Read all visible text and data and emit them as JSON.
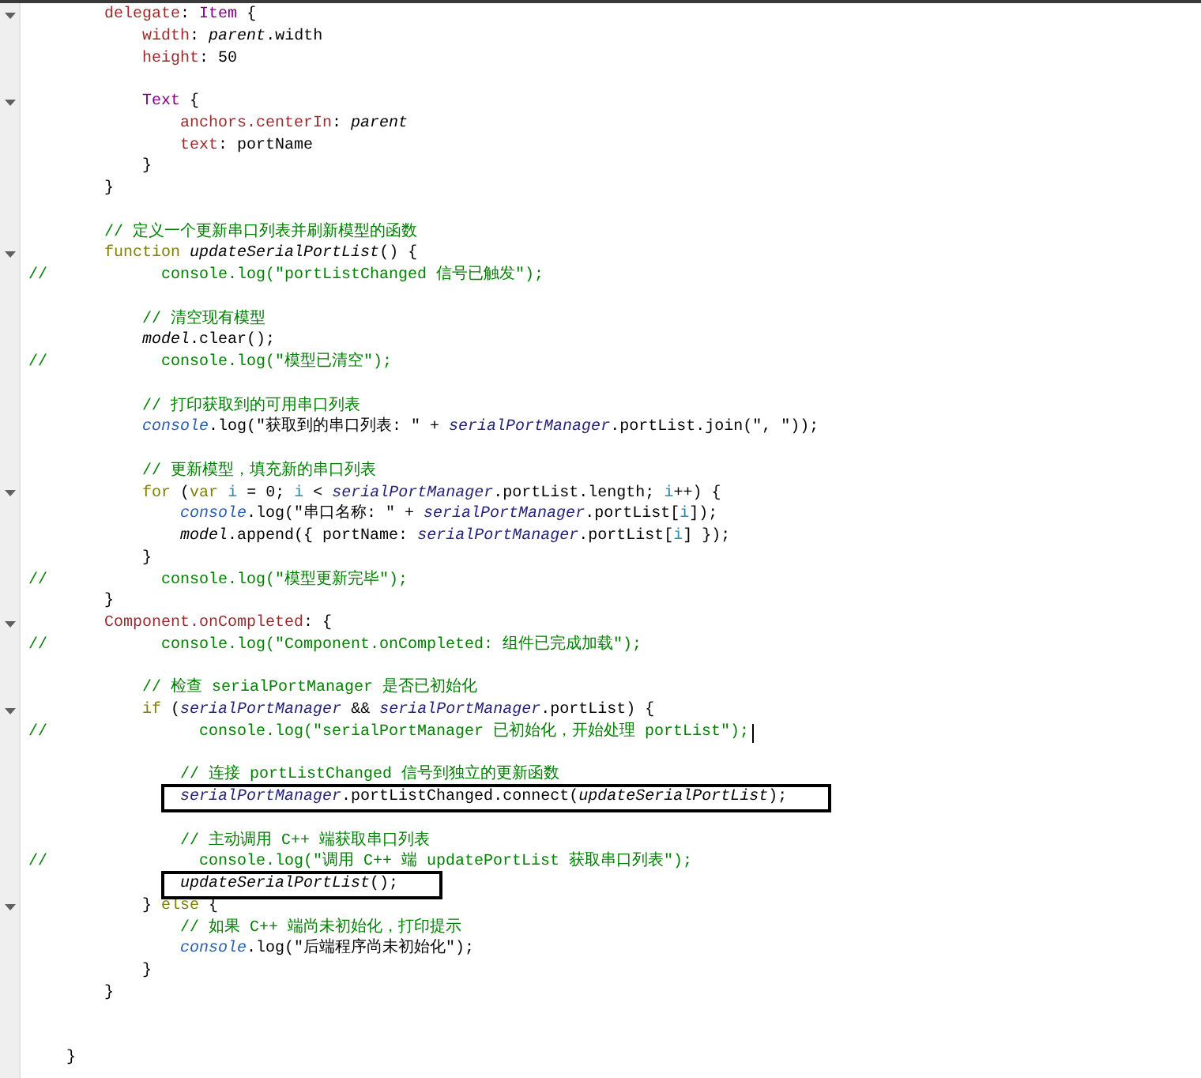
{
  "editor": {
    "lines": [
      {
        "fold": true,
        "boxed": false,
        "cursor": false,
        "tokens": [
          {
            "kind": "property",
            "text": "        delegate"
          },
          {
            "kind": "plain",
            "text": ": "
          },
          {
            "kind": "type",
            "text": "Item"
          },
          {
            "kind": "plain",
            "text": " {"
          }
        ]
      },
      {
        "fold": false,
        "boxed": false,
        "cursor": false,
        "tokens": [
          {
            "kind": "property",
            "text": "            width"
          },
          {
            "kind": "plain",
            "text": ": "
          },
          {
            "kind": "italic",
            "text": "parent"
          },
          {
            "kind": "plain",
            "text": ".width"
          }
        ]
      },
      {
        "fold": false,
        "boxed": false,
        "cursor": false,
        "tokens": [
          {
            "kind": "property",
            "text": "            height"
          },
          {
            "kind": "plain",
            "text": ": 50"
          }
        ]
      },
      {
        "fold": false,
        "boxed": false,
        "cursor": false
      },
      {
        "fold": true,
        "boxed": false,
        "cursor": false,
        "tokens": [
          {
            "kind": "type",
            "text": "            Text"
          },
          {
            "kind": "plain",
            "text": " {"
          }
        ]
      },
      {
        "fold": false,
        "boxed": false,
        "cursor": false,
        "tokens": [
          {
            "kind": "property",
            "text": "                anchors.centerIn"
          },
          {
            "kind": "plain",
            "text": ": "
          },
          {
            "kind": "italic",
            "text": "parent"
          }
        ]
      },
      {
        "fold": false,
        "boxed": false,
        "cursor": false,
        "tokens": [
          {
            "kind": "property",
            "text": "                text"
          },
          {
            "kind": "plain",
            "text": ": portName"
          }
        ]
      },
      {
        "fold": false,
        "boxed": false,
        "cursor": false,
        "tokens": [
          {
            "kind": "plain",
            "text": "            }"
          }
        ]
      },
      {
        "fold": false,
        "boxed": false,
        "cursor": false,
        "tokens": [
          {
            "kind": "plain",
            "text": "        }"
          }
        ]
      },
      {
        "fold": false,
        "boxed": false,
        "cursor": false
      },
      {
        "fold": false,
        "boxed": false,
        "cursor": false,
        "tokens": [
          {
            "kind": "comment",
            "text": "        // 定义一个更新串口列表并刷新模型的函数"
          }
        ]
      },
      {
        "fold": true,
        "boxed": false,
        "cursor": false,
        "tokens": [
          {
            "kind": "keyword",
            "text": "        function"
          },
          {
            "kind": "italic",
            "text": " updateSerialPortList"
          },
          {
            "kind": "plain",
            "text": "() {"
          }
        ]
      },
      {
        "fold": false,
        "boxed": false,
        "cursor": false,
        "tokens": [
          {
            "kind": "comment",
            "text": "//            console.log(\"portListChanged 信号已触发\");"
          }
        ]
      },
      {
        "fold": false,
        "boxed": false,
        "cursor": false
      },
      {
        "fold": false,
        "boxed": false,
        "cursor": false,
        "tokens": [
          {
            "kind": "comment",
            "text": "            // 清空现有模型"
          }
        ]
      },
      {
        "fold": false,
        "boxed": false,
        "cursor": false,
        "tokens": [
          {
            "kind": "italic",
            "text": "            model"
          },
          {
            "kind": "plain",
            "text": ".clear();"
          }
        ]
      },
      {
        "fold": false,
        "boxed": false,
        "cursor": false,
        "tokens": [
          {
            "kind": "comment",
            "text": "//            console.log(\"模型已清空\");"
          }
        ]
      },
      {
        "fold": false,
        "boxed": false,
        "cursor": false
      },
      {
        "fold": false,
        "boxed": false,
        "cursor": false,
        "tokens": [
          {
            "kind": "comment",
            "text": "            // 打印获取到的可用串口列表"
          }
        ]
      },
      {
        "fold": false,
        "boxed": false,
        "cursor": false,
        "tokens": [
          {
            "kind": "builtin",
            "text": "            console"
          },
          {
            "kind": "plain",
            "text": ".log(\"获取到的串口列表: \" + "
          },
          {
            "kind": "object",
            "text": "serialPortManager"
          },
          {
            "kind": "plain",
            "text": ".portList.join(\", \"));"
          }
        ]
      },
      {
        "fold": false,
        "boxed": false,
        "cursor": false
      },
      {
        "fold": false,
        "boxed": false,
        "cursor": false,
        "tokens": [
          {
            "kind": "comment",
            "text": "            // 更新模型，填充新的串口列表"
          }
        ]
      },
      {
        "fold": true,
        "boxed": false,
        "cursor": false,
        "tokens": [
          {
            "kind": "keyword",
            "text": "            for"
          },
          {
            "kind": "plain",
            "text": " ("
          },
          {
            "kind": "keyword",
            "text": "var"
          },
          {
            "kind": "local",
            "text": " i"
          },
          {
            "kind": "plain",
            "text": " = 0; "
          },
          {
            "kind": "local",
            "text": "i"
          },
          {
            "kind": "plain",
            "text": " < "
          },
          {
            "kind": "object",
            "text": "serialPortManager"
          },
          {
            "kind": "plain",
            "text": ".portList.length; "
          },
          {
            "kind": "local",
            "text": "i"
          },
          {
            "kind": "plain",
            "text": "++) {"
          }
        ]
      },
      {
        "fold": false,
        "boxed": false,
        "cursor": false,
        "tokens": [
          {
            "kind": "builtin",
            "text": "                console"
          },
          {
            "kind": "plain",
            "text": ".log(\"串口名称: \" + "
          },
          {
            "kind": "object",
            "text": "serialPortManager"
          },
          {
            "kind": "plain",
            "text": ".portList["
          },
          {
            "kind": "local",
            "text": "i"
          },
          {
            "kind": "plain",
            "text": "]);"
          }
        ]
      },
      {
        "fold": false,
        "boxed": false,
        "cursor": false,
        "tokens": [
          {
            "kind": "italic",
            "text": "                model"
          },
          {
            "kind": "plain",
            "text": ".append({ portName: "
          },
          {
            "kind": "object",
            "text": "serialPortManager"
          },
          {
            "kind": "plain",
            "text": ".portList["
          },
          {
            "kind": "local",
            "text": "i"
          },
          {
            "kind": "plain",
            "text": "] });"
          }
        ]
      },
      {
        "fold": false,
        "boxed": false,
        "cursor": false,
        "tokens": [
          {
            "kind": "plain",
            "text": "            }"
          }
        ]
      },
      {
        "fold": false,
        "boxed": false,
        "cursor": false,
        "tokens": [
          {
            "kind": "comment",
            "text": "//            console.log(\"模型更新完毕\");"
          }
        ]
      },
      {
        "fold": false,
        "boxed": false,
        "cursor": false,
        "tokens": [
          {
            "kind": "plain",
            "text": "        }"
          }
        ]
      },
      {
        "fold": true,
        "boxed": false,
        "cursor": false,
        "tokens": [
          {
            "kind": "property",
            "text": "        Component.onCompleted"
          },
          {
            "kind": "plain",
            "text": ": {"
          }
        ]
      },
      {
        "fold": false,
        "boxed": false,
        "cursor": false,
        "tokens": [
          {
            "kind": "comment",
            "text": "//            console.log(\"Component.onCompleted: 组件已完成加载\");"
          }
        ]
      },
      {
        "fold": false,
        "boxed": false,
        "cursor": false
      },
      {
        "fold": false,
        "boxed": false,
        "cursor": false,
        "tokens": [
          {
            "kind": "comment",
            "text": "            // 检查 serialPortManager 是否已初始化"
          }
        ]
      },
      {
        "fold": true,
        "boxed": false,
        "cursor": false,
        "tokens": [
          {
            "kind": "keyword",
            "text": "            if"
          },
          {
            "kind": "plain",
            "text": " ("
          },
          {
            "kind": "object",
            "text": "serialPortManager"
          },
          {
            "kind": "plain",
            "text": " && "
          },
          {
            "kind": "object",
            "text": "serialPortManager"
          },
          {
            "kind": "plain",
            "text": ".portList) {"
          }
        ]
      },
      {
        "fold": false,
        "boxed": false,
        "cursor": true,
        "tokens": [
          {
            "kind": "comment",
            "text": "//                console.log(\"serialPortManager 已初始化，开始处理 portList\");"
          }
        ]
      },
      {
        "fold": false,
        "boxed": false,
        "cursor": false
      },
      {
        "fold": false,
        "boxed": false,
        "cursor": false,
        "tokens": [
          {
            "kind": "comment",
            "text": "                // 连接 portListChanged 信号到独立的更新函数"
          }
        ]
      },
      {
        "fold": false,
        "boxed": true,
        "cursor": false,
        "tokens": [
          {
            "kind": "object",
            "text": "                serialPortManager"
          },
          {
            "kind": "plain",
            "text": ".portListChanged.connect("
          },
          {
            "kind": "italic",
            "text": "updateSerialPortList"
          },
          {
            "kind": "plain",
            "text": ");"
          }
        ]
      },
      {
        "fold": false,
        "boxed": false,
        "cursor": false
      },
      {
        "fold": false,
        "boxed": false,
        "cursor": false,
        "tokens": [
          {
            "kind": "comment",
            "text": "                // 主动调用 C++ 端获取串口列表"
          }
        ]
      },
      {
        "fold": false,
        "boxed": false,
        "cursor": false,
        "tokens": [
          {
            "kind": "comment",
            "text": "//                console.log(\"调用 C++ 端 updatePortList 获取串口列表\");"
          }
        ]
      },
      {
        "fold": false,
        "boxed": true,
        "cursor": false,
        "tokens": [
          {
            "kind": "italic",
            "text": "                updateSerialPortList"
          },
          {
            "kind": "plain",
            "text": "();"
          }
        ]
      },
      {
        "fold": true,
        "boxed": false,
        "cursor": false,
        "tokens": [
          {
            "kind": "plain",
            "text": "            } "
          },
          {
            "kind": "keyword",
            "text": "else"
          },
          {
            "kind": "plain",
            "text": " {"
          }
        ]
      },
      {
        "fold": false,
        "boxed": false,
        "cursor": false,
        "tokens": [
          {
            "kind": "comment",
            "text": "                // 如果 C++ 端尚未初始化，打印提示"
          }
        ]
      },
      {
        "fold": false,
        "boxed": false,
        "cursor": false,
        "tokens": [
          {
            "kind": "builtin",
            "text": "                console"
          },
          {
            "kind": "plain",
            "text": ".log(\"后端程序尚未初始化\");"
          }
        ]
      },
      {
        "fold": false,
        "boxed": false,
        "cursor": false,
        "tokens": [
          {
            "kind": "plain",
            "text": "            }"
          }
        ]
      },
      {
        "fold": false,
        "boxed": false,
        "cursor": false,
        "tokens": [
          {
            "kind": "plain",
            "text": "        }"
          }
        ]
      },
      {
        "fold": false,
        "boxed": false,
        "cursor": false
      },
      {
        "fold": false,
        "boxed": false,
        "cursor": false
      },
      {
        "fold": false,
        "boxed": false,
        "cursor": false,
        "tokens": [
          {
            "kind": "plain",
            "text": "    }"
          }
        ]
      }
    ]
  }
}
